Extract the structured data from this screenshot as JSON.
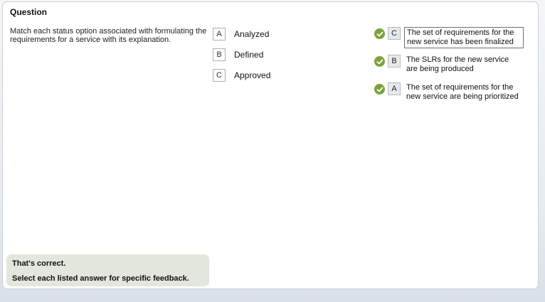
{
  "panel": {
    "title": "Question",
    "question": "Match each status option associated with formulating the requirements for a service with its explanation."
  },
  "choices": [
    {
      "letter": "A",
      "label": "Analyzed"
    },
    {
      "letter": "B",
      "label": "Defined"
    },
    {
      "letter": "C",
      "label": "Approved"
    }
  ],
  "targets": [
    {
      "answer": "C",
      "text": "The set of requirements for the new service has been finalized",
      "status": "correct",
      "icon": "checkmark-icon"
    },
    {
      "answer": "B",
      "text": "The SLRs for the new service are being produced",
      "status": "correct",
      "icon": "checkmark-icon"
    },
    {
      "answer": "A",
      "text": "The set of requirements for the new service are being prioritized",
      "status": "correct",
      "icon": "checkmark-icon"
    }
  ],
  "feedback": {
    "result": "That's correct.",
    "instruction": "Select each listed answer for specific feedback."
  },
  "colors": {
    "correct_check": "#7aa33a",
    "feedback_bg": "#e3e6dc"
  }
}
